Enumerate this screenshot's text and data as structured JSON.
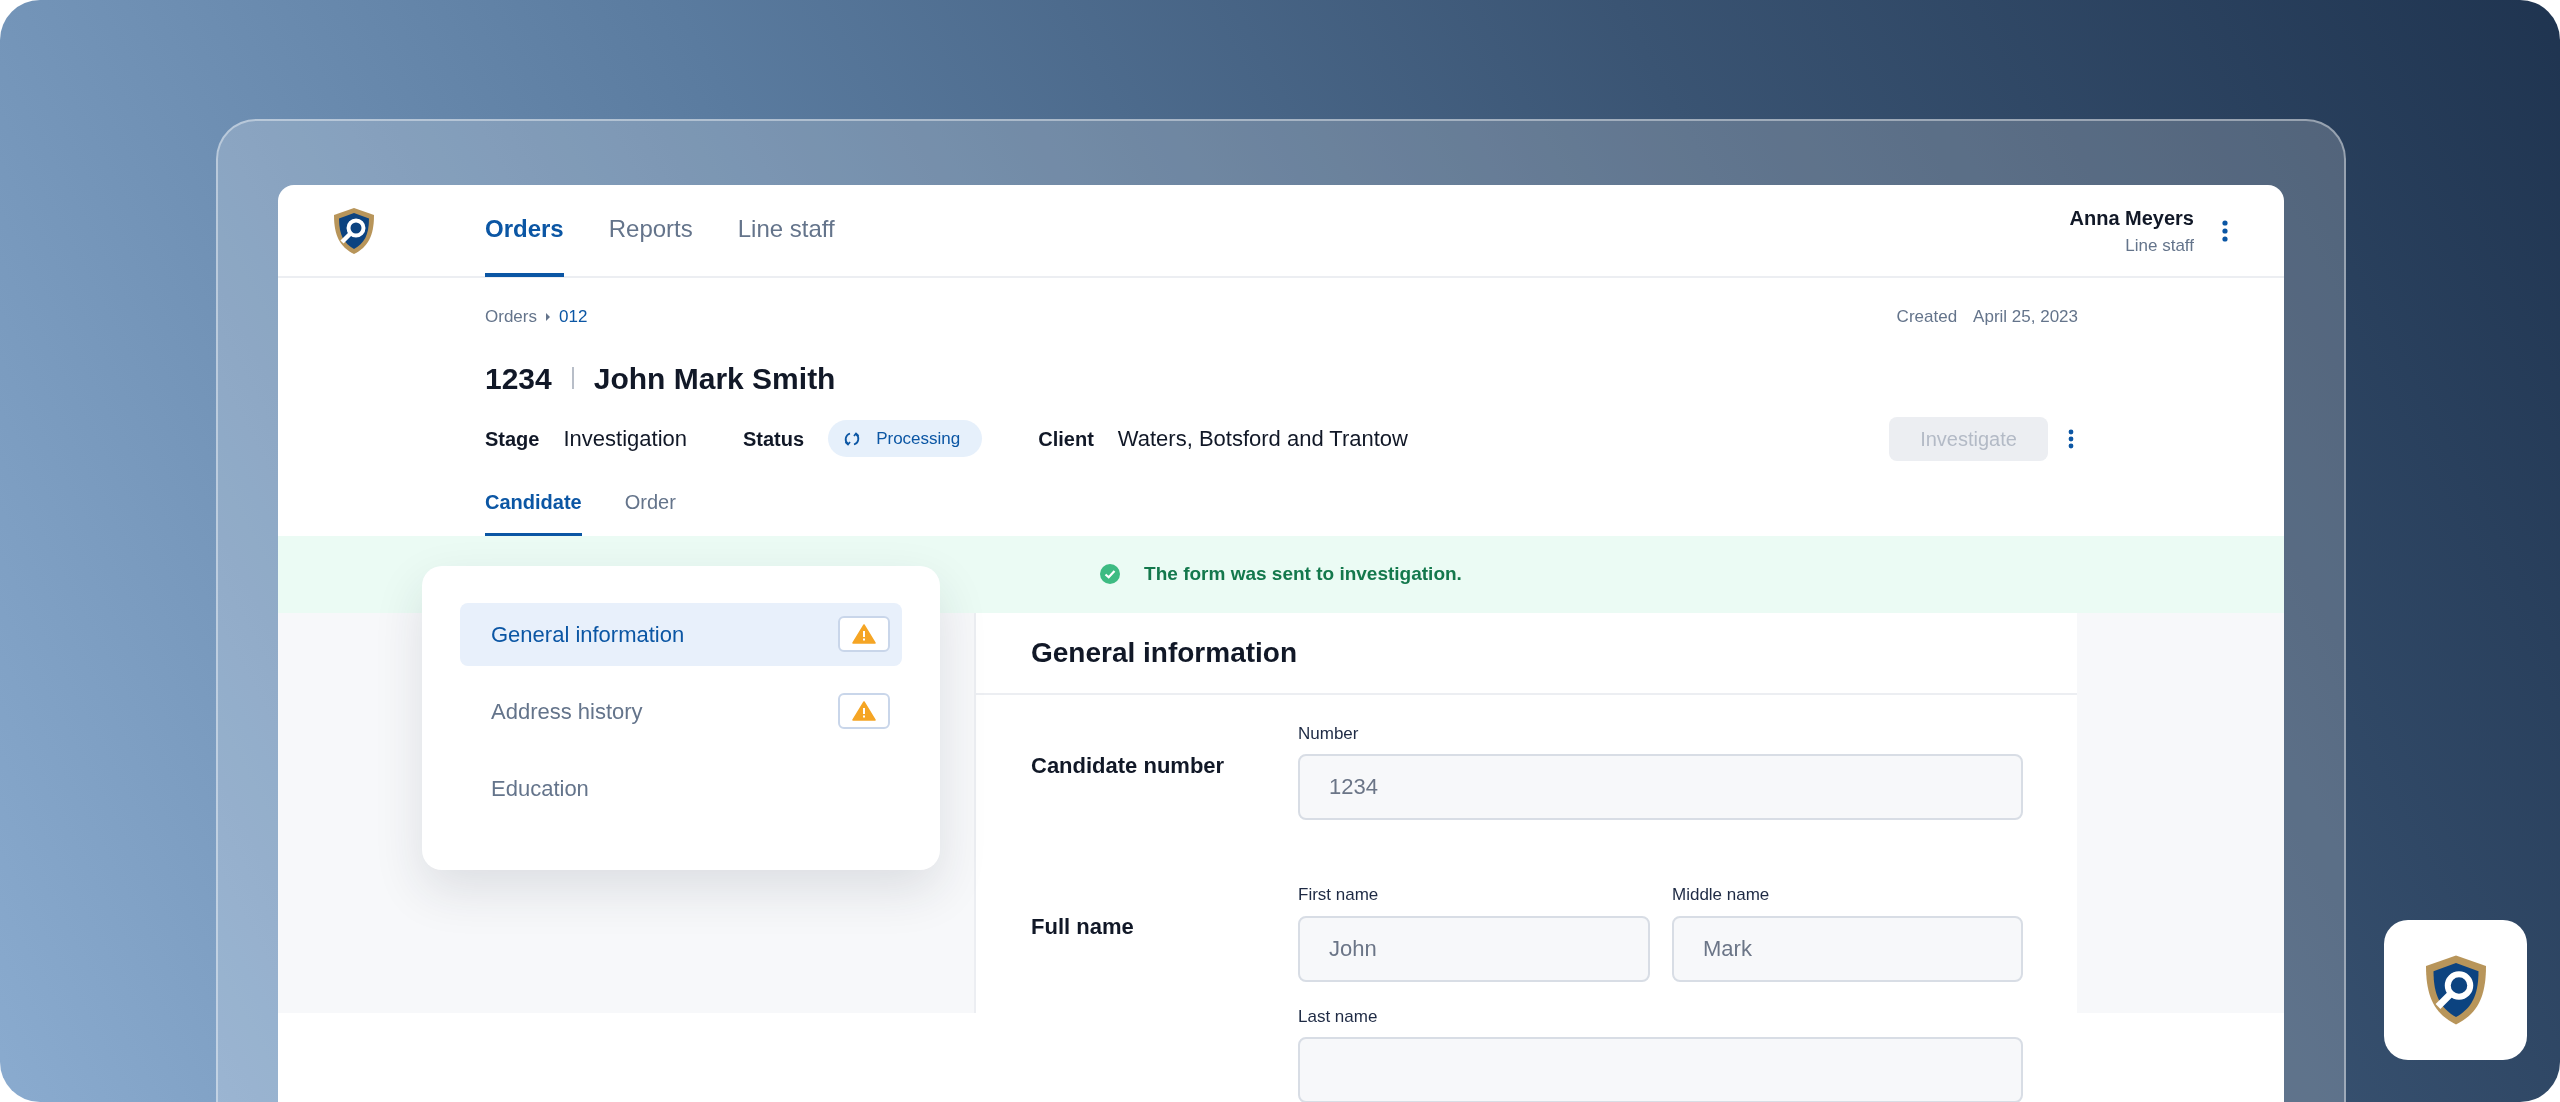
{
  "nav": {
    "tabs": [
      {
        "label": "Orders",
        "selected": true
      },
      {
        "label": "Reports",
        "selected": false
      },
      {
        "label": "Line staff",
        "selected": false
      }
    ]
  },
  "user": {
    "name": "Anna Meyers",
    "role": "Line staff"
  },
  "breadcrumb": [
    "Orders",
    "012"
  ],
  "created": {
    "label": "Created",
    "date": "April 25, 2023"
  },
  "title": {
    "number": "1234",
    "name": "John Mark Smith"
  },
  "meta": {
    "stage_label": "Stage",
    "stage": "Investigation",
    "status_label": "Status",
    "status": "Processing",
    "client_label": "Client",
    "client": "Waters, Botsford and Trantow"
  },
  "investigate": {
    "label": "Investigate",
    "disabled": true
  },
  "subtabs": [
    {
      "label": "Candidate",
      "selected": true
    },
    {
      "label": "Order",
      "selected": false
    }
  ],
  "banner": {
    "text": "The form was sent to investigation."
  },
  "sections": [
    {
      "label": "General information",
      "selected": true,
      "warning": true
    },
    {
      "label": "Address history",
      "selected": false,
      "warning": true
    },
    {
      "label": "Education",
      "selected": false,
      "warning": false
    }
  ],
  "form": {
    "title": "General information",
    "groups": [
      {
        "label": "Candidate number",
        "fields": [
          {
            "label": "Number",
            "placeholder": "1234"
          }
        ]
      },
      {
        "label": "Full name",
        "fields": [
          {
            "label": "First name",
            "placeholder": "John"
          },
          {
            "label": "Middle name",
            "placeholder": "Mark"
          },
          {
            "label": "Last name"
          }
        ]
      }
    ]
  }
}
